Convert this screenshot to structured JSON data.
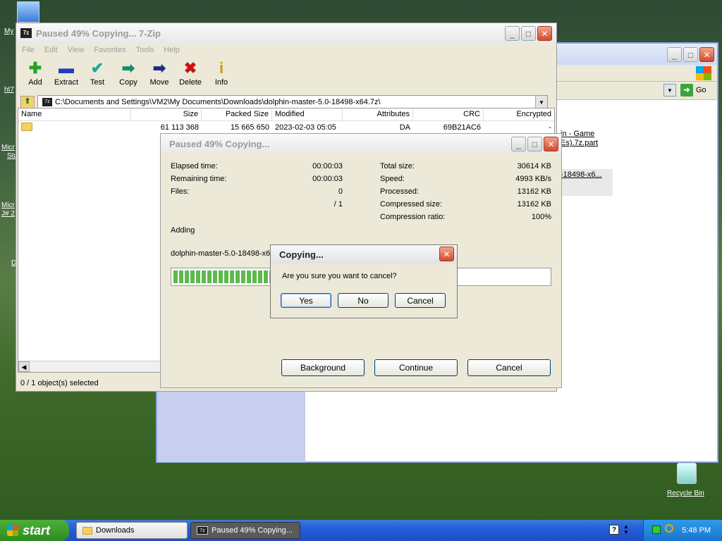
{
  "desktop": {
    "fragments": [
      "My",
      "ht7",
      "Micr",
      "Stu",
      "Micr",
      "J# 2",
      "D"
    ],
    "recycle_bin_label": "Recycle Bin"
  },
  "explorer": {
    "go_label": "Go",
    "file_line1": "in - Game",
    "file_line2": "Es).7z.part",
    "file_line3": "-18498-x6..."
  },
  "zip": {
    "title": "Paused 49% Copying... 7-Zip",
    "menu": [
      "File",
      "Edit",
      "View",
      "Favorites",
      "Tools",
      "Help"
    ],
    "toolbar": [
      {
        "label": "Add",
        "icon": "add-icon",
        "color": "#2aa02a",
        "glyph": "✚"
      },
      {
        "label": "Extract",
        "icon": "extract-icon",
        "color": "#1f3fbf",
        "glyph": "▬"
      },
      {
        "label": "Test",
        "icon": "test-icon",
        "color": "#1aa7a0",
        "glyph": "✔"
      },
      {
        "label": "Copy",
        "icon": "copy-icon",
        "color": "#1a8a70",
        "glyph": "➡"
      },
      {
        "label": "Move",
        "icon": "move-icon",
        "color": "#1a2a8a",
        "glyph": "➡"
      },
      {
        "label": "Delete",
        "icon": "delete-icon",
        "color": "#d01010",
        "glyph": "✖"
      },
      {
        "label": "Info",
        "icon": "info-icon",
        "color": "#c8a000",
        "glyph": "i"
      }
    ],
    "path": "C:\\Documents and Settings\\VM2\\My Documents\\Downloads\\dolphin-master-5.0-18498-x64.7z\\",
    "columns": [
      "Name",
      "Size",
      "Packed Size",
      "Modified",
      "Attributes",
      "CRC",
      "Encrypted"
    ],
    "row": {
      "name": "",
      "size": "61 113 368",
      "packed": "15 665 650",
      "modified": "2023-02-03 05:05",
      "attributes": "DA",
      "crc": "69B21AC6",
      "encrypted": "-"
    },
    "status": "0 / 1 object(s) selected"
  },
  "progress": {
    "title": "Paused 49% Copying...",
    "elapsed_label": "Elapsed time:",
    "elapsed": "00:00:03",
    "remaining_label": "Remaining time:",
    "remaining": "00:00:03",
    "files_label": "Files:",
    "files": "0",
    "files_total": "/ 1",
    "total_label": "Total size:",
    "total": "30614 KB",
    "speed_label": "Speed:",
    "speed": "4993 KB/s",
    "processed_label": "Processed:",
    "processed": "13162 KB",
    "compressed_label": "Compressed size:",
    "compressed": "13162 KB",
    "ratio_label": "Compression ratio:",
    "ratio": "100%",
    "action": "Adding",
    "filename": "dolphin-master-5.0-18498-x64.",
    "percent": 0.49,
    "background_label": "Background",
    "continue_label": "Continue",
    "cancel_label": "Cancel"
  },
  "confirm": {
    "title": "Copying...",
    "message": "Are you sure you want to cancel?",
    "yes": "Yes",
    "no": "No",
    "cancel": "Cancel"
  },
  "taskbar": {
    "start": "start",
    "tasks": [
      "Downloads",
      "Paused 49% Copying..."
    ],
    "clock": "5:48 PM"
  }
}
